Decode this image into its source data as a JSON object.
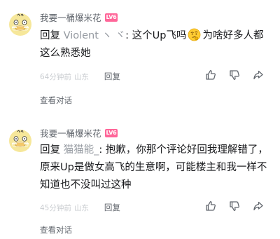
{
  "comments": [
    {
      "username": "我要一桶爆米花",
      "level": "LV6",
      "reply_prefix": "回复",
      "reply_to": "Violent ヽ ヾ",
      "text_before_emoji": ": 这个Up飞吗",
      "emoji": "thinking-face-emoji",
      "text_after_emoji": "为啥好多人都这么熟悉她",
      "time": "64分钟前",
      "region": "山东",
      "reply_label": "回复",
      "view_thread_label": "查看对话"
    },
    {
      "username": "我要一桶爆米花",
      "level": "LV6",
      "reply_prefix": "回复",
      "reply_to": "猫猫能_",
      "text": ": 抱歉，你那个评论好回我理解错了，原来Up是做女高飞的生意啊，可能楼主和我一样不知道也不没叫过这种",
      "time": "45分钟前",
      "region": "山东",
      "reply_label": "回复",
      "view_thread_label": "查看对话"
    }
  ],
  "icons": {
    "avatar": "psyduck-avatar",
    "like": "thumbs-up-icon",
    "dislike": "thumbs-down-icon",
    "share": "share-icon"
  },
  "colors": {
    "level_badge": "#ff6699",
    "muted_text": "#9499a0",
    "meta_text": "#c9ccd0"
  }
}
